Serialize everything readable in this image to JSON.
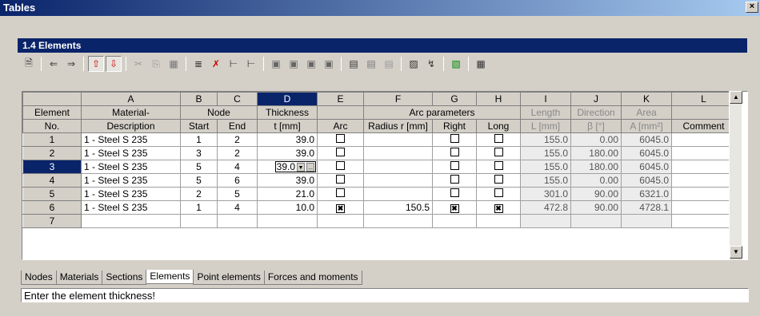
{
  "window": {
    "title": "Tables",
    "close": "×"
  },
  "panel": {
    "title": "1.4 Elements"
  },
  "toolbar": {
    "icons": [
      "properties-icon",
      "arrow-left-icon",
      "arrow-right-icon",
      "select-up-icon",
      "select-down-icon",
      "cut-icon",
      "copy-icon",
      "paste-icon",
      "insert-row-icon",
      "delete-row-icon",
      "insert-above-icon",
      "insert-below-icon",
      "col-a-icon",
      "col-b-icon",
      "col-c-icon",
      "col-d-icon",
      "table-a-icon",
      "table-b-icon",
      "table-c-icon",
      "graphic-icon",
      "measure-icon",
      "import-icon",
      "calculator-icon"
    ]
  },
  "grid": {
    "col_letters": [
      "A",
      "B",
      "C",
      "D",
      "E",
      "F",
      "G",
      "H",
      "I",
      "J",
      "K",
      "L"
    ],
    "header1": {
      "element": "Element",
      "material": "Material-",
      "node": "Node",
      "thickness": "Thickness",
      "arc_params": "Arc parameters",
      "length": "Length",
      "direction": "Direction",
      "area": "Area"
    },
    "header2": {
      "no": "No.",
      "description": "Description",
      "start": "Start",
      "end": "End",
      "t": "t [mm]",
      "arc": "Arc",
      "radius": "Radius r [mm]",
      "right": "Right",
      "long": "Long",
      "L": "L [mm]",
      "beta": "β [°]",
      "A": "A [mm²]",
      "comment": "Comment"
    },
    "rows": [
      {
        "no": "1",
        "mat": "1 - Steel S 235",
        "start": "1",
        "end": "2",
        "t": "39.0",
        "arc": false,
        "r": "",
        "right": false,
        "long": false,
        "L": "155.0",
        "beta": "0.00",
        "A": "6045.0"
      },
      {
        "no": "2",
        "mat": "1 - Steel S 235",
        "start": "3",
        "end": "2",
        "t": "39.0",
        "arc": false,
        "r": "",
        "right": false,
        "long": false,
        "L": "155.0",
        "beta": "180.00",
        "A": "6045.0"
      },
      {
        "no": "3",
        "mat": "1 - Steel S 235",
        "start": "5",
        "end": "4",
        "t": "39.0",
        "arc": false,
        "r": "",
        "right": false,
        "long": false,
        "L": "155.0",
        "beta": "180.00",
        "A": "6045.0"
      },
      {
        "no": "4",
        "mat": "1 - Steel S 235",
        "start": "5",
        "end": "6",
        "t": "39.0",
        "arc": false,
        "r": "",
        "right": false,
        "long": false,
        "L": "155.0",
        "beta": "0.00",
        "A": "6045.0"
      },
      {
        "no": "5",
        "mat": "1 - Steel S 235",
        "start": "2",
        "end": "5",
        "t": "21.0",
        "arc": false,
        "r": "",
        "right": false,
        "long": false,
        "L": "301.0",
        "beta": "90.00",
        "A": "6321.0"
      },
      {
        "no": "6",
        "mat": "1 - Steel S 235",
        "start": "1",
        "end": "4",
        "t": "10.0",
        "arc": true,
        "r": "150.5",
        "right": true,
        "long": true,
        "L": "472.8",
        "beta": "90.00",
        "A": "4728.1"
      },
      {
        "no": "7",
        "mat": "",
        "start": "",
        "end": "",
        "t": "",
        "arc": null,
        "r": "",
        "right": null,
        "long": null,
        "L": "",
        "beta": "",
        "A": ""
      }
    ],
    "active_row": "3",
    "active_col": "D",
    "edit_button": "..."
  },
  "tabs": [
    "Nodes",
    "Materials",
    "Sections",
    "Elements",
    "Point elements",
    "Forces and moments"
  ],
  "active_tab": "Elements",
  "status": "Enter the element thickness!"
}
